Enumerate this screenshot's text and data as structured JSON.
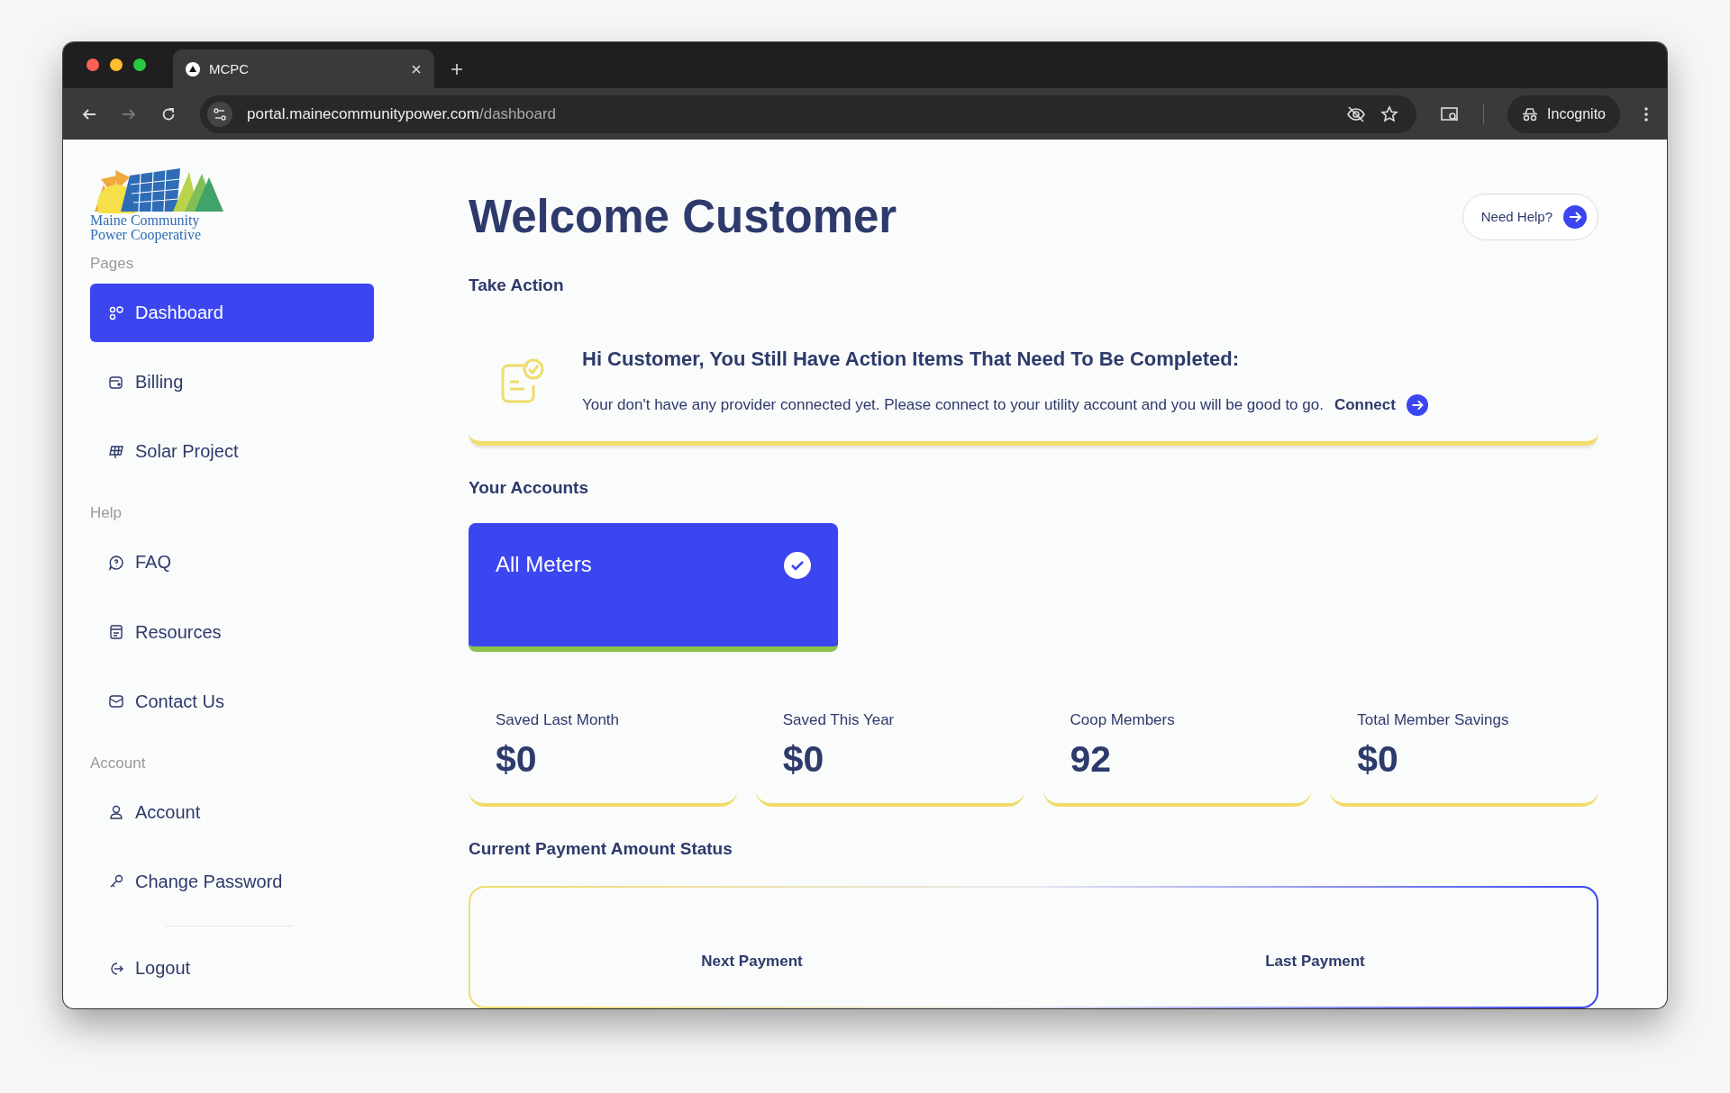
{
  "browser": {
    "tab_title": "MCPC",
    "url_host": "portal.mainecommunitypower.com",
    "url_path": "/dashboard",
    "profile": "Incognito"
  },
  "logo": {
    "line_1": "Maine Community",
    "line_2": "Power Cooperative"
  },
  "sidebar": {
    "sections": [
      {
        "heading": "Pages",
        "items": [
          {
            "label": "Dashboard",
            "selected": true
          },
          {
            "label": "Billing",
            "selected": false
          },
          {
            "label": "Solar Project",
            "selected": false
          }
        ]
      },
      {
        "heading": "Help",
        "items": [
          {
            "label": "FAQ",
            "selected": false
          },
          {
            "label": "Resources",
            "selected": false
          },
          {
            "label": "Contact Us",
            "selected": false
          }
        ]
      },
      {
        "heading": "Account",
        "items": [
          {
            "label": "Account",
            "selected": false
          },
          {
            "label": "Change Password",
            "selected": false
          }
        ]
      }
    ],
    "logout": "Logout"
  },
  "header": {
    "title": "Welcome Customer",
    "help_button": "Need Help?"
  },
  "take_action": {
    "heading": "Take Action",
    "title": "Hi Customer, You Still Have Action Items That Need To Be Completed:",
    "message": "Your don't have any provider connected yet. Please connect to your utility account and you will be good to go.",
    "link": "Connect"
  },
  "accounts": {
    "heading": "Your Accounts",
    "cards": [
      {
        "label": "All Meters",
        "selected": true
      }
    ]
  },
  "stats": [
    {
      "label": "Saved Last Month",
      "value": "$0"
    },
    {
      "label": "Saved This Year",
      "value": "$0"
    },
    {
      "label": "Coop Members",
      "value": "92"
    },
    {
      "label": "Total Member Savings",
      "value": "$0"
    }
  ],
  "payments": {
    "heading": "Current Payment Amount Status",
    "items": [
      {
        "label": "Next Payment"
      },
      {
        "label": "Last Payment"
      }
    ]
  }
}
